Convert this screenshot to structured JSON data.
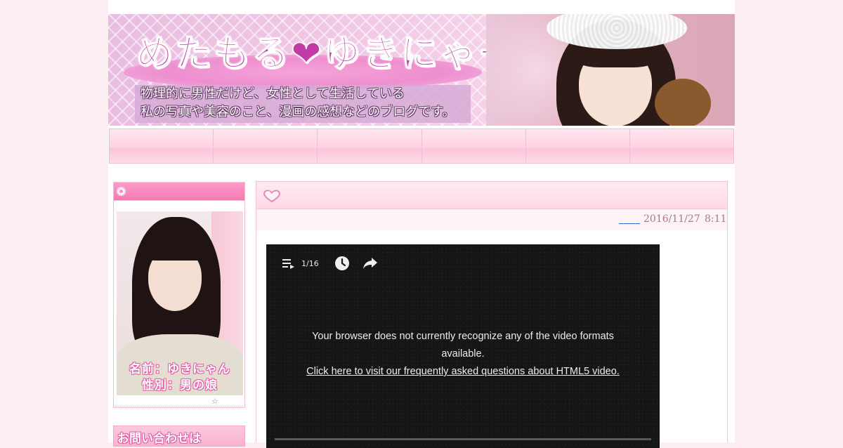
{
  "header": {
    "title": "めたもる❤ゆきにゃー",
    "tagline_line1": "物理的に男性だけど、女性として生活している",
    "tagline_line2": "私の写真や美容のこと、漫画の感想などのブログです。"
  },
  "nav": {
    "items": [
      {
        "label": ""
      },
      {
        "label": ""
      },
      {
        "label": ""
      },
      {
        "label": ""
      },
      {
        "label": ""
      },
      {
        "label": ""
      }
    ]
  },
  "sidebar": {
    "profile": {
      "caption_name": "名前：ゆきにゃん",
      "caption_gender": "性別：男の娘",
      "star": "☆"
    },
    "contact_banner": "お問い合わせは"
  },
  "article": {
    "date": "2016/11/27",
    "time": "8:11",
    "video": {
      "playlist_position": "1/16",
      "message": "Your browser does not currently recognize any of the video formats available.",
      "faq_link": "Click here to visit our frequently asked questions about HTML5 video."
    }
  },
  "colors": {
    "page_background": "#fdeef4",
    "accent_pink": "#f27ab3",
    "nav_pink": "#ffd3e3",
    "video_background": "#151515"
  }
}
